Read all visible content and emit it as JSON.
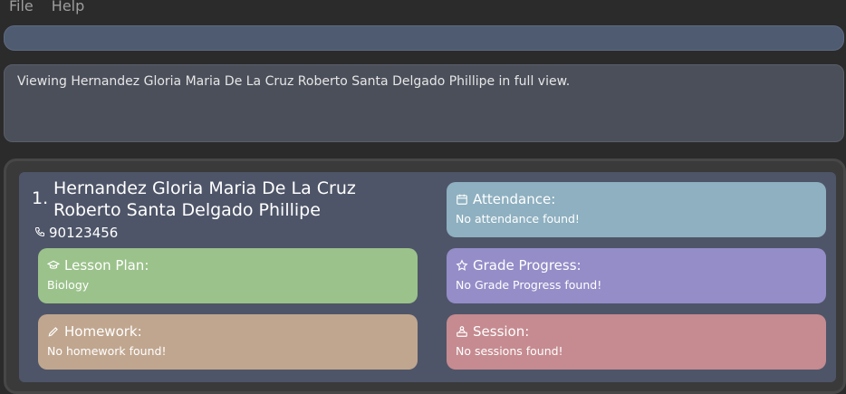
{
  "menu": {
    "file_label": "File",
    "help_label": "Help"
  },
  "command": {
    "value": ""
  },
  "result": {
    "text": "Viewing Hernandez Gloria Maria De La Cruz Roberto Santa Delgado Phillipe in full view."
  },
  "student": {
    "index": "1.",
    "name": "Hernandez Gloria Maria De La Cruz Roberto Santa Delgado Phillipe",
    "phone": "90123456",
    "phone_icon": "phone-icon"
  },
  "tiles": {
    "lesson_plan": {
      "title": "Lesson Plan:",
      "value": "Biology",
      "icon": "graduation-cap-icon",
      "color": "#9bc28b"
    },
    "homework": {
      "title": "Homework:",
      "value": "No homework found!",
      "icon": "pencil-icon",
      "color": "#c0a68f"
    },
    "attendance": {
      "title": "Attendance:",
      "value": "No attendance found!",
      "icon": "calendar-icon",
      "color": "#8eb0c0"
    },
    "grade_progress": {
      "title": "Grade Progress:",
      "value": "No Grade Progress found!",
      "icon": "star-icon",
      "color": "#948dc8"
    },
    "session": {
      "title": "Session:",
      "value": "No sessions found!",
      "icon": "person-at-desk-icon",
      "color": "#c58b90"
    }
  },
  "colors": {
    "background": "#2b2b2b",
    "command_box": "#4e5b71",
    "result_box": "#4b4f5a",
    "card": "#4e5568"
  }
}
